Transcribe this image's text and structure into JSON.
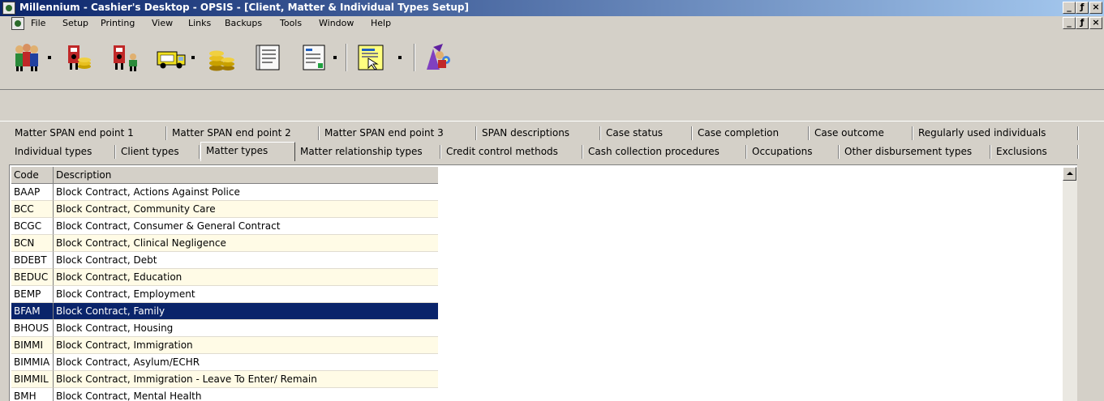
{
  "window": {
    "title": "Millennium - Cashier's Desktop - OPSIS - [Client, Matter & Individual Types Setup]",
    "minimize": "_",
    "restore": "ƒ",
    "close": "×"
  },
  "menu": {
    "items": [
      {
        "label": "File"
      },
      {
        "label": "Setup"
      },
      {
        "label": "Printing"
      },
      {
        "label": "View"
      },
      {
        "label": "Links"
      },
      {
        "label": "Backups"
      },
      {
        "label": "Tools"
      },
      {
        "label": "Window"
      },
      {
        "label": "Help"
      }
    ]
  },
  "toolbar": {
    "icons": [
      "clients-icon",
      "cashier-money-icon",
      "cashier-person-icon",
      "supplier-van-icon",
      "coins-icon",
      "document-icon",
      "form-icon",
      "select-form-icon",
      "wizard-icon"
    ]
  },
  "tabs": {
    "row1": [
      {
        "label": "Matter SPAN end point 1"
      },
      {
        "label": "Matter SPAN end point 2"
      },
      {
        "label": "Matter SPAN end point 3"
      },
      {
        "label": "SPAN descriptions"
      },
      {
        "label": "Case status"
      },
      {
        "label": "Case completion"
      },
      {
        "label": "Case outcome"
      },
      {
        "label": "Regularly used individuals"
      }
    ],
    "row2": [
      {
        "label": "Individual types"
      },
      {
        "label": "Client types"
      },
      {
        "label": "Matter types"
      },
      {
        "label": "Matter relationship types"
      },
      {
        "label": "Credit control methods"
      },
      {
        "label": "Cash collection procedures"
      },
      {
        "label": "Occupations"
      },
      {
        "label": "Other disbursement types"
      },
      {
        "label": "Exclusions"
      }
    ],
    "active": "Matter types"
  },
  "grid": {
    "columns": [
      "Code",
      "Description"
    ],
    "selected_code": "BFAM",
    "rows": [
      {
        "code": "BAAP",
        "description": "Block Contract, Actions Against Police"
      },
      {
        "code": "BCC",
        "description": "Block Contract, Community Care"
      },
      {
        "code": "BCGC",
        "description": "Block Contract, Consumer & General Contract"
      },
      {
        "code": "BCN",
        "description": "Block Contract, Clinical Negligence"
      },
      {
        "code": "BDEBT",
        "description": "Block Contract, Debt"
      },
      {
        "code": "BEDUC",
        "description": "Block Contract, Education"
      },
      {
        "code": "BEMP",
        "description": "Block Contract, Employment"
      },
      {
        "code": "BFAM",
        "description": "Block Contract, Family"
      },
      {
        "code": "BHOUS",
        "description": "Block Contract, Housing"
      },
      {
        "code": "BIMMI",
        "description": "Block Contract, Immigration"
      },
      {
        "code": "BIMMIA",
        "description": "Block Contract, Asylum/ECHR"
      },
      {
        "code": "BIMMIL",
        "description": "Block Contract, Immigration - Leave To Enter/ Remain"
      },
      {
        "code": "BMH",
        "description": "Block Contract, Mental Health"
      }
    ]
  },
  "colors": {
    "titlebar_start": "#0a246a",
    "titlebar_end": "#a6caf0",
    "selection": "#0a246a",
    "row_alt": "#fffbe6",
    "face": "#d4d0c8"
  }
}
